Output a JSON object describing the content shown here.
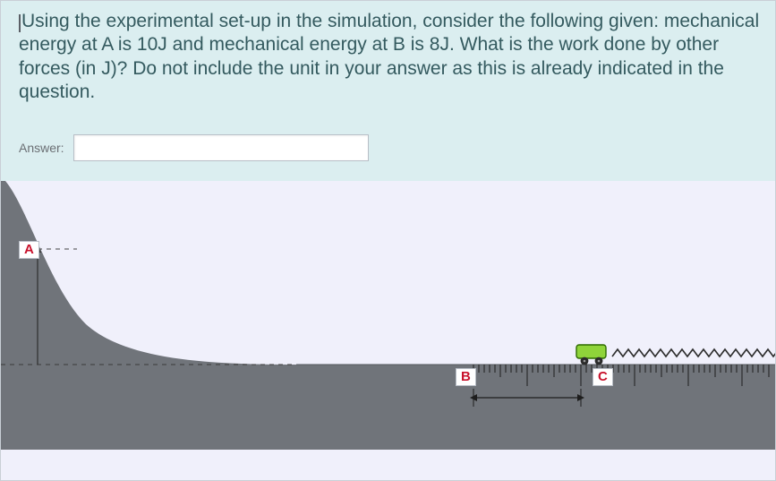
{
  "question": {
    "text": "Using the experimental set-up in the simulation, consider the following given: mechanical energy at A is 10J and mechanical energy at B is 8J. What is the work done by other forces (in J)? Do not include the unit in your answer as this is already indicated in the question."
  },
  "answer": {
    "label": "Answer:",
    "value": ""
  },
  "points": {
    "A": "A",
    "B": "B",
    "C": "C"
  }
}
